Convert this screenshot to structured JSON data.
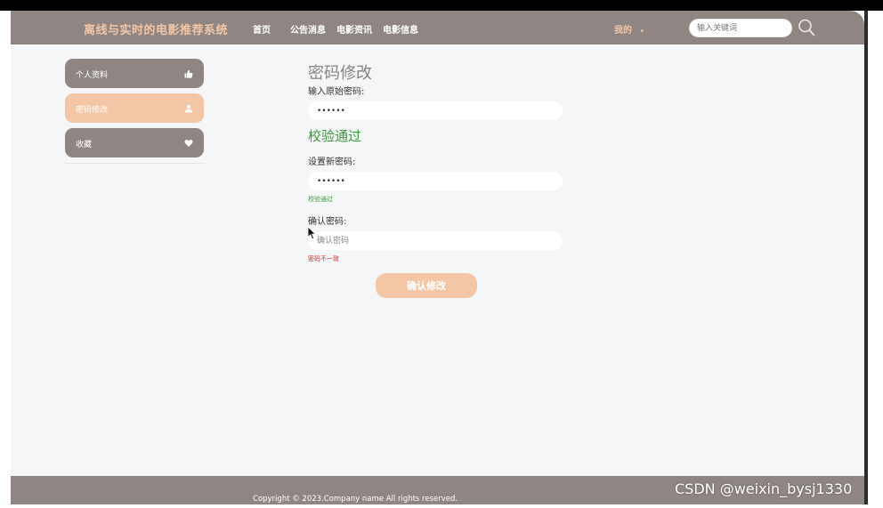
{
  "header": {
    "brand": "离线与实时的电影推荐系统",
    "nav": [
      {
        "label": "首页"
      },
      {
        "label": "公告消息"
      },
      {
        "label": "电影资讯"
      },
      {
        "label": "电影信息"
      }
    ],
    "user_menu": "我的",
    "search_placeholder": "输入关键词"
  },
  "sidebar": {
    "items": [
      {
        "label": "个人资料",
        "icon": "thumbs-up-icon",
        "active": false
      },
      {
        "label": "密码修改",
        "icon": "user-icon",
        "active": true
      },
      {
        "label": "收藏",
        "icon": "heart-icon",
        "active": false
      }
    ]
  },
  "form": {
    "title": "密码修改",
    "old_password_label": "输入原始密码:",
    "old_password_value": "••••••",
    "old_check_status": "校验通过",
    "new_password_label": "设置新密码:",
    "new_password_value": "••••••",
    "new_check_status": "校验通过",
    "confirm_label": "确认密码:",
    "confirm_placeholder": "确认密码",
    "confirm_error": "密码不一致",
    "submit_label": "确认修改"
  },
  "footer": {
    "copyright": "Copyright © 2023.Company name All rights reserved."
  },
  "watermark": "CSDN @weixin_bysj1330",
  "colors": {
    "header_bg": "#8f8684",
    "brand": "#f3c6a6",
    "accent": "#f3c6a6",
    "success": "#3a9a3a",
    "error": "#c93a3a",
    "page_bg": "#f4f6f7"
  }
}
